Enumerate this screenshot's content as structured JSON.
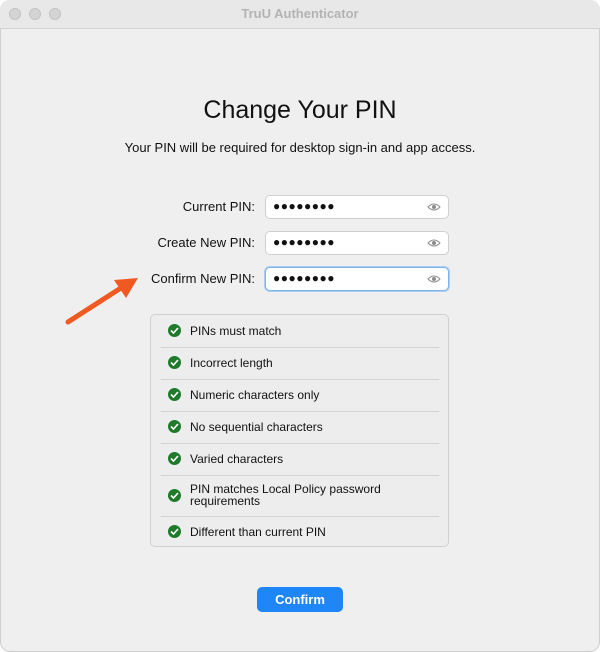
{
  "window": {
    "title": "TruU Authenticator"
  },
  "page": {
    "heading": "Change Your PIN",
    "subtitle": "Your PIN will be required for desktop sign-in and app access."
  },
  "fields": {
    "current": {
      "label": "Current PIN:",
      "value": "●●●●●●●●"
    },
    "create": {
      "label": "Create New PIN:",
      "value": "●●●●●●●●"
    },
    "confirm": {
      "label": "Confirm New PIN:",
      "value": "●●●●●●●●"
    }
  },
  "rules": [
    {
      "text": "PINs must match",
      "status": "pass"
    },
    {
      "text": "Incorrect length",
      "status": "pass"
    },
    {
      "text": "Numeric characters only",
      "status": "pass"
    },
    {
      "text": "No sequential characters",
      "status": "pass"
    },
    {
      "text": "Varied characters",
      "status": "pass"
    },
    {
      "text": "PIN matches Local Policy password requirements",
      "status": "pass"
    },
    {
      "text": "Different than current PIN",
      "status": "pass"
    }
  ],
  "buttons": {
    "confirm_label": "Confirm"
  },
  "colors": {
    "accent": "#1f86f7",
    "check": "#1f7a2a",
    "annotation_arrow": "#f05a22"
  },
  "icons": {
    "field_reveal": "eye-icon",
    "rule_status": "check-circle-icon"
  }
}
